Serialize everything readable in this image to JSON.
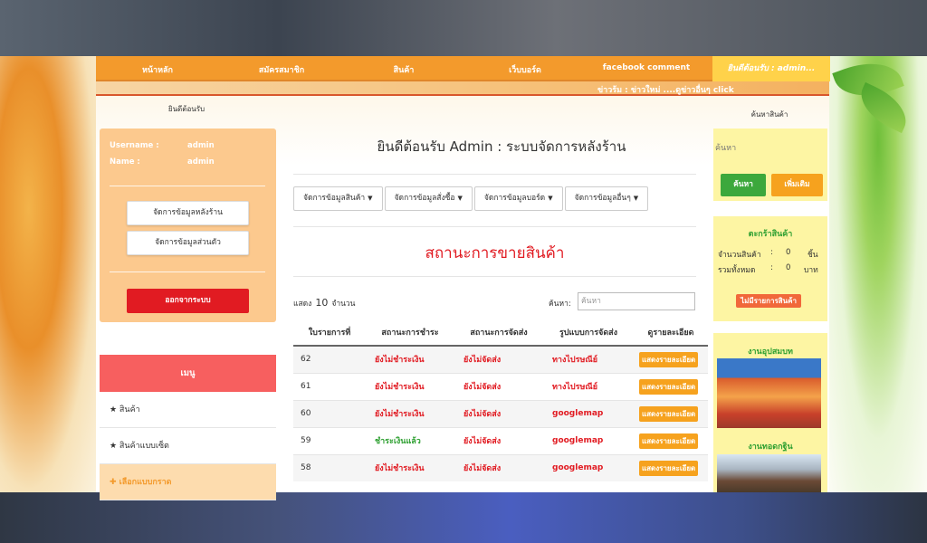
{
  "nav": {
    "items": [
      "หน้าหลัก",
      "สมัครสมาชิก",
      "สินค้า",
      "เว็บบอร์ด",
      "facebook comment"
    ],
    "welcome": "ยินดีต้อนรับ : admin..."
  },
  "news": "ข่าวร้ม : ข่าวใหม่ ....ดูข่าวอื่นๆ click",
  "left": {
    "heading": "ยินดีต้อนรับ",
    "username_label": "Username :",
    "username_value": "admin",
    "name_label": "Name :",
    "name_value": "admin",
    "btn_backend": "จัดการข้อมูลหลังร้าน",
    "btn_personal": "จัดการข้อมูลส่วนตัว",
    "btn_logout": "ออกจากระบบ",
    "menu_title": "เมนู",
    "menu_items": [
      "★ สินค้า",
      "★ สินค้าแบบเซ็ต",
      "✚ เลือกแบบกราด"
    ]
  },
  "main": {
    "title": "ยินดีต้อนรับ Admin : ระบบจัดการหลังร้าน",
    "dropdowns": [
      "จัดการข้อมูลสินค้า",
      "จัดการข้อมูลสั่งซื้อ",
      "จัดการข้อมูลบอร์ด",
      "จัดการข้อมูลอื่นๆ"
    ],
    "section_title": "สถานะการขายสินค้า",
    "show_label": "แสดง",
    "show_count": "10",
    "show_unit": "จำนวน",
    "search_label": "ค้นหา:",
    "search_placeholder": "ค้นหา",
    "columns": [
      "ใบรายการที่",
      "สถานะการชำระ",
      "สถานะการจัดส่ง",
      "รูปแบบการจัดส่ง",
      "ดูรายละเอียด"
    ],
    "rows": [
      {
        "id": "62",
        "pay": "ยังไม่ชำระเงิน",
        "paid": false,
        "ship": "ยังไม่จัดส่ง",
        "method": "ทางไปรษณีย์",
        "detail": "แสดงรายละเอียด"
      },
      {
        "id": "61",
        "pay": "ยังไม่ชำระเงิน",
        "paid": false,
        "ship": "ยังไม่จัดส่ง",
        "method": "ทางไปรษณีย์",
        "detail": "แสดงรายละเอียด"
      },
      {
        "id": "60",
        "pay": "ยังไม่ชำระเงิน",
        "paid": false,
        "ship": "ยังไม่จัดส่ง",
        "method": "googlemap",
        "detail": "แสดงรายละเอียด"
      },
      {
        "id": "59",
        "pay": "ชำระเงินแล้ว",
        "paid": true,
        "ship": "ยังไม่จัดส่ง",
        "method": "googlemap",
        "detail": "แสดงรายละเอียด"
      },
      {
        "id": "58",
        "pay": "ยังไม่ชำระเงิน",
        "paid": false,
        "ship": "ยังไม่จัดส่ง",
        "method": "googlemap",
        "detail": "แสดงรายละเอียด"
      }
    ]
  },
  "right": {
    "search_heading": "ค้นหาสินค้า",
    "search_placeholder": "ค้นหา",
    "btn_search": "ค้นหา",
    "btn_add": "เพิ่มเติม",
    "cart_title": "ตะกร้าสินค้า",
    "cart_qty_label": "จำนวนสินค้า",
    "cart_qty_value": "0",
    "cart_qty_unit": "ชิ้น",
    "cart_total_label": "รวมทั้งหมด",
    "cart_total_value": "0",
    "cart_total_unit": "บาท",
    "cart_btn": "ไม่มีรายการสินค้า",
    "gallery_1": "งานอุปสมบท",
    "gallery_2": "งานทอดกฐิน"
  },
  "colors": {
    "nav": "#f39a2c",
    "accent_red": "#e11b22",
    "green": "#2fa032",
    "menu_head": "#f75f5f"
  }
}
